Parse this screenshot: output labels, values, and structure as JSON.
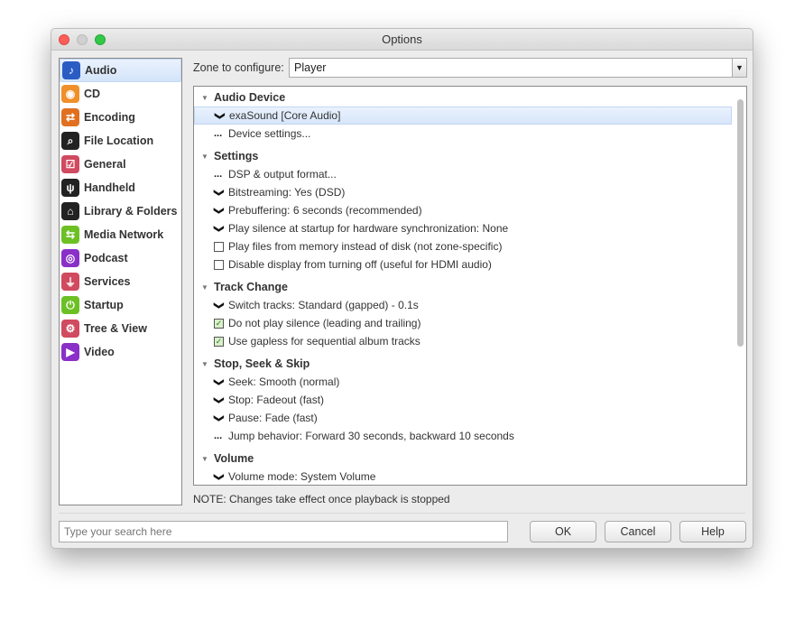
{
  "window": {
    "title": "Options"
  },
  "sidebar": {
    "items": [
      {
        "label": "Audio",
        "icon": "music-note-icon",
        "color": "#2a5cc4",
        "glyph": "♪",
        "selected": true
      },
      {
        "label": "CD",
        "icon": "cd-icon",
        "color": "#f0902a",
        "glyph": "◉"
      },
      {
        "label": "Encoding",
        "icon": "arrows-icon",
        "color": "#e07020",
        "glyph": "⇄"
      },
      {
        "label": "File Location",
        "icon": "file-search-icon",
        "color": "#222222",
        "glyph": "⌕"
      },
      {
        "label": "General",
        "icon": "checkbox-icon",
        "color": "#d04a60",
        "glyph": "☑"
      },
      {
        "label": "Handheld",
        "icon": "usb-icon",
        "color": "#222222",
        "glyph": "ψ"
      },
      {
        "label": "Library & Folders",
        "icon": "house-icon",
        "color": "#222222",
        "glyph": "⌂"
      },
      {
        "label": "Media Network",
        "icon": "network-icon",
        "color": "#6cc024",
        "glyph": "⇆"
      },
      {
        "label": "Podcast",
        "icon": "podcast-icon",
        "color": "#8a30c8",
        "glyph": "◎"
      },
      {
        "label": "Services",
        "icon": "plug-icon",
        "color": "#d04a60",
        "glyph": "⏚"
      },
      {
        "label": "Startup",
        "icon": "power-icon",
        "color": "#6cc024",
        "glyph": "⏻"
      },
      {
        "label": "Tree & View",
        "icon": "gear-icon",
        "color": "#d04a60",
        "glyph": "⚙"
      },
      {
        "label": "Video",
        "icon": "camera-icon",
        "color": "#8a30c8",
        "glyph": "▶"
      }
    ]
  },
  "zone": {
    "label": "Zone to configure:",
    "value": "Player"
  },
  "tree": [
    {
      "type": "header",
      "label": "Audio Device"
    },
    {
      "type": "dropdown",
      "label": "exaSound [Core Audio]",
      "selected": true
    },
    {
      "type": "action",
      "label": "Device settings..."
    },
    {
      "type": "header",
      "label": "Settings"
    },
    {
      "type": "action",
      "label": "DSP & output format..."
    },
    {
      "type": "dropdown",
      "label": "Bitstreaming: Yes (DSD)"
    },
    {
      "type": "dropdown",
      "label": "Prebuffering: 6 seconds (recommended)"
    },
    {
      "type": "dropdown",
      "label": "Play silence at startup for hardware synchronization: None"
    },
    {
      "type": "checkbox",
      "label": "Play files from memory instead of disk (not zone-specific)",
      "checked": false
    },
    {
      "type": "checkbox",
      "label": "Disable display from turning off (useful for HDMI audio)",
      "checked": false
    },
    {
      "type": "header",
      "label": "Track Change"
    },
    {
      "type": "dropdown",
      "label": "Switch tracks: Standard (gapped) - 0.1s"
    },
    {
      "type": "checkbox",
      "label": "Do not play silence (leading and trailing)",
      "checked": true
    },
    {
      "type": "checkbox",
      "label": "Use gapless for sequential album tracks",
      "checked": true
    },
    {
      "type": "header",
      "label": "Stop, Seek & Skip"
    },
    {
      "type": "dropdown",
      "label": "Seek: Smooth (normal)"
    },
    {
      "type": "dropdown",
      "label": "Stop: Fadeout (fast)"
    },
    {
      "type": "dropdown",
      "label": "Pause: Fade (fast)"
    },
    {
      "type": "action",
      "label": "Jump behavior: Forward 30 seconds, backward 10 seconds"
    },
    {
      "type": "header",
      "label": "Volume"
    },
    {
      "type": "dropdown",
      "label": "Volume mode: System Volume"
    }
  ],
  "note": "NOTE: Changes take effect once playback is stopped",
  "search": {
    "placeholder": "Type your search here",
    "value": ""
  },
  "buttons": {
    "ok": "OK",
    "cancel": "Cancel",
    "help": "Help"
  }
}
